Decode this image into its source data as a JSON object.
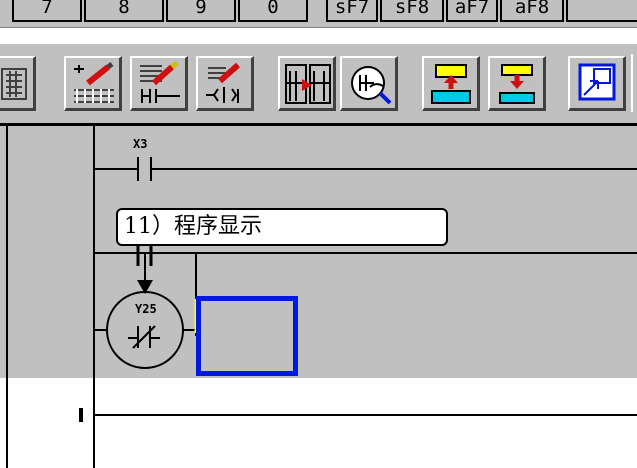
{
  "function_keys": [
    "7",
    "8",
    "9",
    "0",
    "sF7",
    "sF8",
    "aF7",
    "aF8"
  ],
  "toolbar": {
    "buttons": [
      {
        "name": "grid-partial",
        "icon": "grid-icon"
      },
      {
        "name": "write-line",
        "icon": "draw-line-icon"
      },
      {
        "name": "delete-line",
        "icon": "delete-line-icon"
      },
      {
        "name": "edit-segment",
        "icon": "edit-segment-icon"
      },
      {
        "name": "device-search",
        "icon": "device-search-icon"
      },
      {
        "name": "monitor",
        "icon": "monitor-icon"
      },
      {
        "name": "transfer-up",
        "icon": "upload-icon"
      },
      {
        "name": "transfer-down",
        "icon": "download-icon"
      },
      {
        "name": "window-view",
        "icon": "window-icon"
      }
    ]
  },
  "ladder": {
    "contact_label": "X3",
    "coil_label": "Y25",
    "tooltip": "11）程序显示"
  },
  "colors": {
    "cursor": "#0018e0",
    "background": "#c0c0c0",
    "marker": "#ffff00"
  }
}
